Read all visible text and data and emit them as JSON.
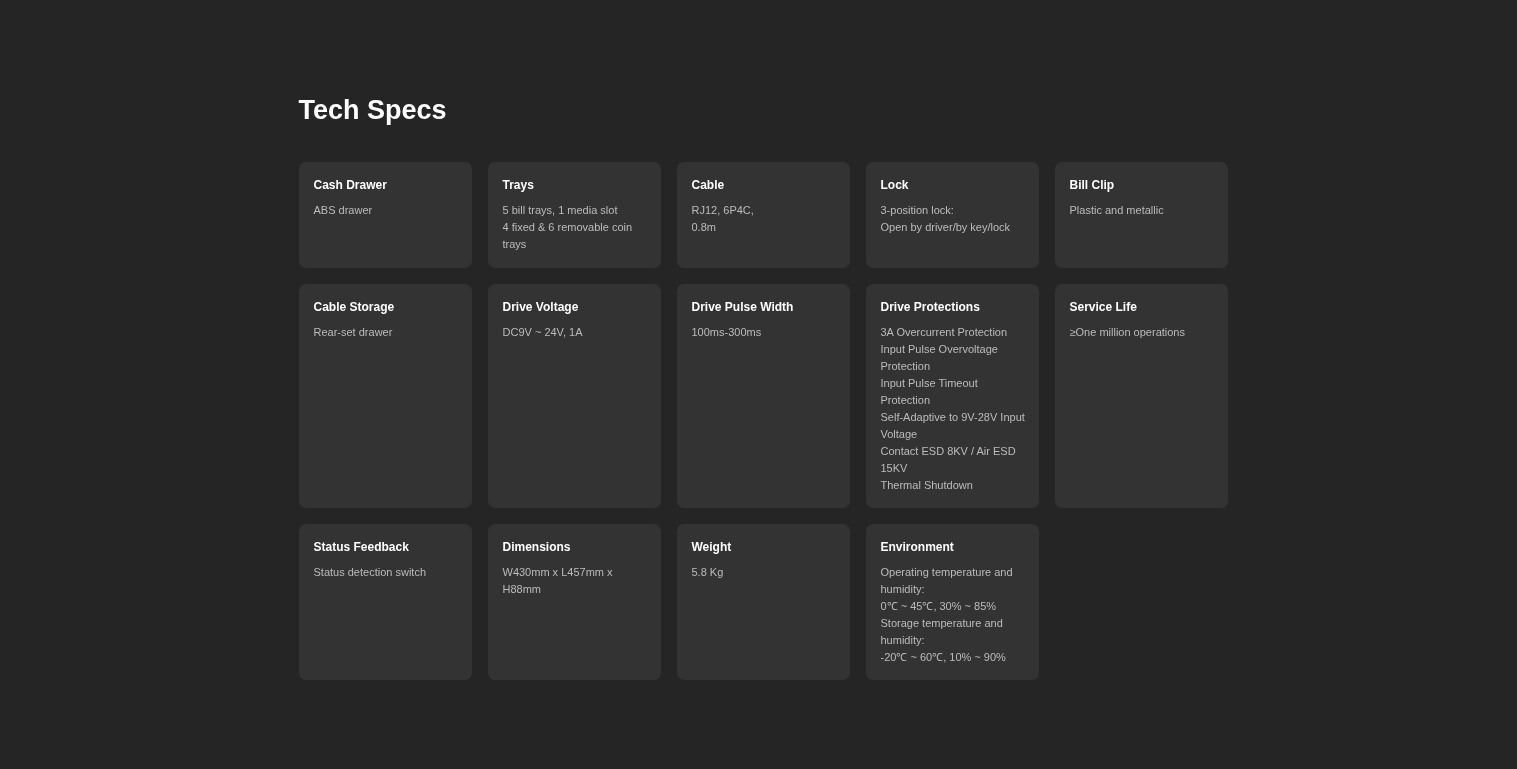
{
  "title": "Tech Specs",
  "specs": [
    {
      "label": "Cash Drawer",
      "lines": [
        "ABS drawer"
      ]
    },
    {
      "label": "Trays",
      "lines": [
        "5 bill trays, 1 media slot",
        "4 fixed & 6 removable coin trays"
      ]
    },
    {
      "label": "Cable",
      "lines": [
        "RJ12, 6P4C,",
        "0.8m"
      ]
    },
    {
      "label": "Lock",
      "lines": [
        "3-position lock:",
        "Open by driver/by key/lock"
      ]
    },
    {
      "label": "Bill Clip",
      "lines": [
        "Plastic and metallic"
      ]
    },
    {
      "label": "Cable Storage",
      "lines": [
        "Rear-set drawer"
      ]
    },
    {
      "label": "Drive Voltage",
      "lines": [
        "DC9V ~ 24V, 1A"
      ]
    },
    {
      "label": "Drive Pulse Width",
      "lines": [
        "100ms-300ms"
      ]
    },
    {
      "label": "Drive Protections",
      "lines": [
        "3A Overcurrent Protection",
        "Input Pulse Overvoltage Protection",
        "Input Pulse Timeout Protection",
        "Self-Adaptive to 9V-28V Input Voltage",
        "Contact ESD 8KV / Air ESD 15KV",
        "Thermal Shutdown"
      ]
    },
    {
      "label": "Service Life",
      "lines": [
        "≥One million operations"
      ]
    },
    {
      "label": "Status Feedback",
      "lines": [
        "Status detection switch"
      ]
    },
    {
      "label": "Dimensions",
      "lines": [
        "W430mm x L457mm x H88mm"
      ]
    },
    {
      "label": "Weight",
      "lines": [
        "5.8 Kg"
      ]
    },
    {
      "label": "Environment",
      "lines": [
        "Operating temperature and humidity:",
        "0℃ ~ 45℃, 30% ~ 85%",
        "Storage temperature and humidity:",
        "-20℃ ~ 60℃, 10% ~ 90%"
      ]
    }
  ]
}
